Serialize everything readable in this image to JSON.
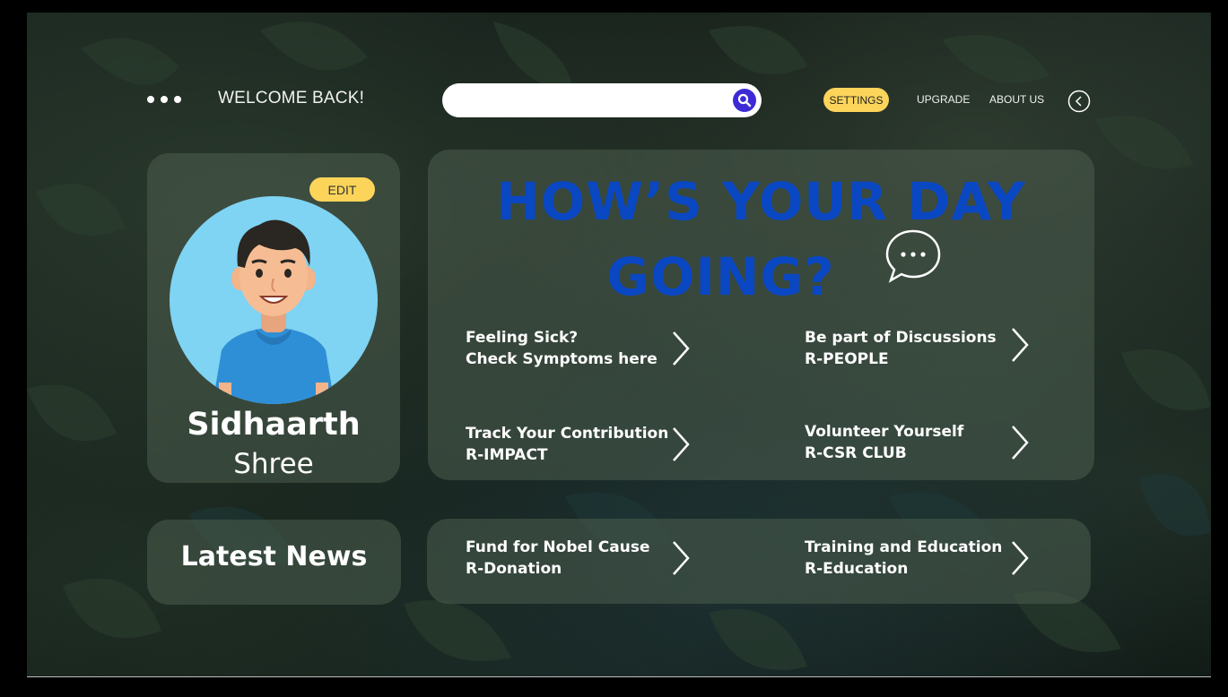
{
  "header": {
    "menu_icon": "ellipsis-icon",
    "welcome": "WELCOME BACK!",
    "search_placeholder": "",
    "search_icon": "search-icon",
    "nav": {
      "settings": "SETTINGS",
      "upgrade": "UPGRADE",
      "about": "ABOUT US"
    },
    "back_icon": "back-arrow-icon"
  },
  "profile": {
    "edit_label": "EDIT",
    "first_name": "Sidhaarth",
    "last_name": "Shree"
  },
  "main": {
    "greeting_line1": "HOW’S YOUR DAY",
    "greeting_line2": "GOING?",
    "links": [
      {
        "line1": "Feeling Sick?",
        "line2": "Check Symptoms here"
      },
      {
        "line1": "Be part of Discussions",
        "line2": "R-PEOPLE"
      },
      {
        "line1": "Track Your Contribution",
        "line2": "R-IMPACT"
      },
      {
        "line1": "Volunteer  Yourself",
        "line2": "R-CSR CLUB"
      }
    ]
  },
  "news": {
    "title": "Latest News"
  },
  "bottom_links": [
    {
      "line1": "Fund for Nobel Cause",
      "line2": "R-Donation"
    },
    {
      "line1": "Training and Education",
      "line2": "R-Education"
    }
  ],
  "colors": {
    "accent_yellow": "#fcd45a",
    "greeting_blue": "#0a47c2",
    "search_button": "#3d2ad6",
    "panel": "rgba(78,95,80,0.52)"
  }
}
